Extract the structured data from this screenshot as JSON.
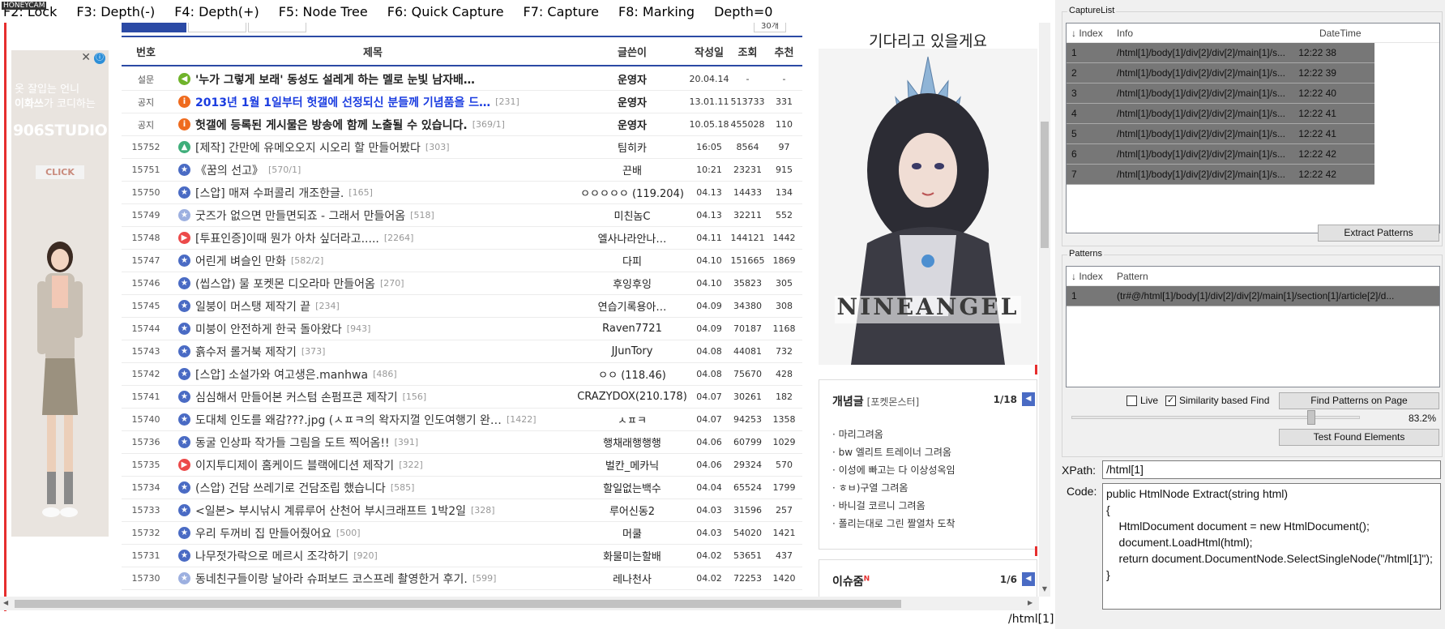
{
  "watermark": "HONEYCAM",
  "menu": {
    "items": [
      "F2: Lock",
      "F3: Depth(-)",
      "F4: Depth(+)",
      "F5: Node Tree",
      "F6: Quick Capture",
      "F7: Capture",
      "F8: Marking",
      "Depth=0"
    ]
  },
  "left_ad": {
    "line1": "옷 잘입는 언니",
    "line2_bold": "이화쓰",
    "line2_rest": "가 코디하는",
    "brand": "906STUDIO",
    "click": "CLICK",
    "info_icon": "ⓘ",
    "close_icon": "✕"
  },
  "board": {
    "page_size_label": "30개",
    "headers": {
      "no": "번호",
      "title": "제목",
      "author": "글쓴이",
      "date": "작성일",
      "views": "조회",
      "rec": "추천"
    },
    "rows": [
      {
        "no": "설문",
        "icon": "green",
        "glyph": "◀",
        "title": "'누가 그렇게 보래' 동성도 설레게 하는 멜로 눈빛 남자배…",
        "count": "",
        "author": "운영자",
        "date": "20.04.14",
        "views": "-",
        "rec": "-",
        "kind": "notice"
      },
      {
        "no": "공지",
        "icon": "orange",
        "glyph": "i",
        "title": "2013년 1월 1일부터 헛갤에 선정되신 분들께 기념품을 드…",
        "count": "[231]",
        "author": "운영자",
        "date": "13.01.11",
        "views": "513733",
        "rec": "331",
        "kind": "notice blue"
      },
      {
        "no": "공지",
        "icon": "orange",
        "glyph": "i",
        "title": "헛갤에 등록된 게시물은 방송에 함께 노출될 수 있습니다.",
        "count": "[369/1]",
        "author": "운영자",
        "date": "10.05.18",
        "views": "455028",
        "rec": "110",
        "kind": "notice"
      },
      {
        "no": "15752",
        "icon": "camp",
        "glyph": "▲",
        "title": "[제작] 간만에 유메오오지 시오리 할 만들어봤다",
        "count": "[303]",
        "author": "팀히카",
        "date": "16:05",
        "views": "8564",
        "rec": "97",
        "kind": ""
      },
      {
        "no": "15751",
        "icon": "star",
        "glyph": "★",
        "title": "《꿈의 선고》",
        "count": "[570/1]",
        "author": "끈배",
        "date": "10:21",
        "views": "23231",
        "rec": "915",
        "kind": ""
      },
      {
        "no": "15750",
        "icon": "star",
        "glyph": "★",
        "title": "[스압] 매져 수퍼콜리 개조한글.",
        "count": "[165]",
        "author": "ㅇㅇㅇㅇㅇ (119.204)",
        "date": "04.13",
        "views": "14433",
        "rec": "134",
        "kind": ""
      },
      {
        "no": "15749",
        "icon": "star-light",
        "glyph": "★",
        "title": "굿즈가 없으면 만들면되죠 - 그래서 만들어옴",
        "count": "[518]",
        "author": "미친놈C",
        "date": "04.13",
        "views": "32211",
        "rec": "552",
        "kind": ""
      },
      {
        "no": "15748",
        "icon": "play",
        "glyph": "▶",
        "title": "[투표인증]이때 뭔가 아차 싶더라고.....",
        "count": "[2264]",
        "author": "엘사나라안나…",
        "date": "04.11",
        "views": "144121",
        "rec": "1442",
        "kind": ""
      },
      {
        "no": "15747",
        "icon": "star",
        "glyph": "★",
        "title": "어린게 벼슬인 만화",
        "count": "[582/2]",
        "author": "다피",
        "date": "04.10",
        "views": "151665",
        "rec": "1869",
        "kind": ""
      },
      {
        "no": "15746",
        "icon": "star",
        "glyph": "★",
        "title": "(씹스압) 물 포켓몬 디오라마 만들어옴",
        "count": "[270]",
        "author": "후잉후잉",
        "date": "04.10",
        "views": "35823",
        "rec": "305",
        "kind": ""
      },
      {
        "no": "15745",
        "icon": "star",
        "glyph": "★",
        "title": "일붕이 머스탱 제작기 끝",
        "count": "[234]",
        "author": "연습기록용아…",
        "date": "04.09",
        "views": "34380",
        "rec": "308",
        "kind": ""
      },
      {
        "no": "15744",
        "icon": "star",
        "glyph": "★",
        "title": "미붕이 안전하게 한국 돌아왔다",
        "count": "[943]",
        "author": "Raven7721",
        "date": "04.09",
        "views": "70187",
        "rec": "1168",
        "kind": ""
      },
      {
        "no": "15743",
        "icon": "star",
        "glyph": "★",
        "title": "흙수저 롤거북 제작기",
        "count": "[373]",
        "author": "JJunTory",
        "date": "04.08",
        "views": "44081",
        "rec": "732",
        "kind": ""
      },
      {
        "no": "15742",
        "icon": "star",
        "glyph": "★",
        "title": "[스압] 소설가와 여고생은.manhwa",
        "count": "[486]",
        "author": "ㅇㅇ (118.46)",
        "date": "04.08",
        "views": "75670",
        "rec": "428",
        "kind": ""
      },
      {
        "no": "15741",
        "icon": "star",
        "glyph": "★",
        "title": "심심해서 만들어본 커스텀 손펌프콘 제작기",
        "count": "[156]",
        "author": "CRAZYDOX(210.178)",
        "date": "04.07",
        "views": "30261",
        "rec": "182",
        "kind": ""
      },
      {
        "no": "15740",
        "icon": "star",
        "glyph": "★",
        "title": "도대체 인도를 왜감???.jpg (ㅅㅍㅋ의 왁자지껄 인도여행기 완…",
        "count": "[1422]",
        "author": "ㅅㅍㅋ",
        "date": "04.07",
        "views": "94253",
        "rec": "1358",
        "kind": ""
      },
      {
        "no": "15736",
        "icon": "star",
        "glyph": "★",
        "title": "동굴 인상파 작가들 그림을 도트 찍어옴!!",
        "count": "[391]",
        "author": "행채래행행행",
        "date": "04.06",
        "views": "60799",
        "rec": "1029",
        "kind": ""
      },
      {
        "no": "15735",
        "icon": "play",
        "glyph": "▶",
        "title": "이지투디제이 홈케이드 블랙에디션 제작기",
        "count": "[322]",
        "author": "벌칸_메카닉",
        "date": "04.06",
        "views": "29324",
        "rec": "570",
        "kind": ""
      },
      {
        "no": "15734",
        "icon": "star",
        "glyph": "★",
        "title": "(스압) 건담 쓰레기로 건담조립 했습니다",
        "count": "[585]",
        "author": "할일없는백수",
        "date": "04.04",
        "views": "65524",
        "rec": "1799",
        "kind": ""
      },
      {
        "no": "15733",
        "icon": "star",
        "glyph": "★",
        "title": "<일본> 부시낚시 계류루어 산천어 부시크래프트 1박2일",
        "count": "[328]",
        "author": "루어신동2",
        "date": "04.03",
        "views": "31596",
        "rec": "257",
        "kind": ""
      },
      {
        "no": "15732",
        "icon": "star",
        "glyph": "★",
        "title": "우리 두꺼비 집 만들어줬어요",
        "count": "[500]",
        "author": "머쿨",
        "date": "04.03",
        "views": "54020",
        "rec": "1421",
        "kind": ""
      },
      {
        "no": "15731",
        "icon": "star",
        "glyph": "★",
        "title": "나무젓가락으로 메르시 조각하기",
        "count": "[920]",
        "author": "화물미는할배",
        "date": "04.02",
        "views": "53651",
        "rec": "437",
        "kind": ""
      },
      {
        "no": "15730",
        "icon": "star-light",
        "glyph": "★",
        "title": "동네친구들이랑 날아라 슈퍼보드 코스프레 촬영한거 후기.",
        "count": "[599]",
        "author": "레나천사",
        "date": "04.02",
        "views": "72253",
        "rec": "1420",
        "kind": ""
      }
    ]
  },
  "right_ad": {
    "headline": "기다리고 있을게요",
    "game_logo": "NINEANGEL"
  },
  "concept_box": {
    "title": "개념글",
    "subtitle": "[포켓몬스터]",
    "page": "1/18",
    "btn": "◀",
    "items": [
      "· 마리그려옴",
      "· bw 엘리트 트레이너 그려옴",
      "· 이성에 빠고는 다 이상성옥임",
      "· ㅎㅂ)구열 그려옴",
      "· 바니걸 코르니 그려옴",
      "· 폴리는대로 그린 짤열차 도착"
    ]
  },
  "issue_box": {
    "title": "이슈줌",
    "badge": "N",
    "page": "1/6",
    "btn": "◀"
  },
  "browser_status": "/html[1]",
  "tool": {
    "capture_title": "CaptureList",
    "capture_headers": {
      "index": "Index",
      "info": "Info",
      "datetime": "DateTime"
    },
    "captures": [
      {
        "index": "1",
        "info": "/html[1]/body[1]/div[2]/div[2]/main[1]/s...",
        "time": "12:22 38"
      },
      {
        "index": "2",
        "info": "/html[1]/body[1]/div[2]/div[2]/main[1]/s...",
        "time": "12:22 39"
      },
      {
        "index": "3",
        "info": "/html[1]/body[1]/div[2]/div[2]/main[1]/s...",
        "time": "12:22 40"
      },
      {
        "index": "4",
        "info": "/html[1]/body[1]/div[2]/div[2]/main[1]/s...",
        "time": "12:22 41"
      },
      {
        "index": "5",
        "info": "/html[1]/body[1]/div[2]/div[2]/main[1]/s...",
        "time": "12:22 41"
      },
      {
        "index": "6",
        "info": "/html[1]/body[1]/div[2]/div[2]/main[1]/s...",
        "time": "12:22 42"
      },
      {
        "index": "7",
        "info": "/html[1]/body[1]/div[2]/div[2]/main[1]/s...",
        "time": "12:22 42"
      }
    ],
    "extract_btn": "Extract Patterns",
    "patterns_title": "Patterns",
    "pattern_headers": {
      "index": "Index",
      "pattern": "Pattern"
    },
    "patterns": [
      {
        "index": "1",
        "pattern": "(tr#@/html[1]/body[1]/div[2]/div[2]/main[1]/section[1]/article[2]/d..."
      }
    ],
    "live_label": "Live",
    "live_checked": false,
    "similarity_label": "Similarity based Find",
    "similarity_checked": true,
    "find_btn": "Find Patterns on Page",
    "similarity_value": "83.2%",
    "similarity_level": 0.832,
    "test_btn": "Test Found Elements",
    "xpath_label": "XPath:",
    "xpath_value": "/html[1]",
    "code_label": "Code:",
    "code_lines": [
      "public HtmlNode Extract(string html)",
      "{",
      "    HtmlDocument document = new HtmlDocument();",
      "    document.LoadHtml(html);",
      "    return document.DocumentNode.SelectSingleNode(\"/html[1]\");",
      "}"
    ]
  },
  "colors": {
    "board_accent": "#2b4aa5",
    "notice_blue": "#1a3ce0",
    "red_bar": "#e62e2e",
    "selection_gray": "#777777"
  }
}
